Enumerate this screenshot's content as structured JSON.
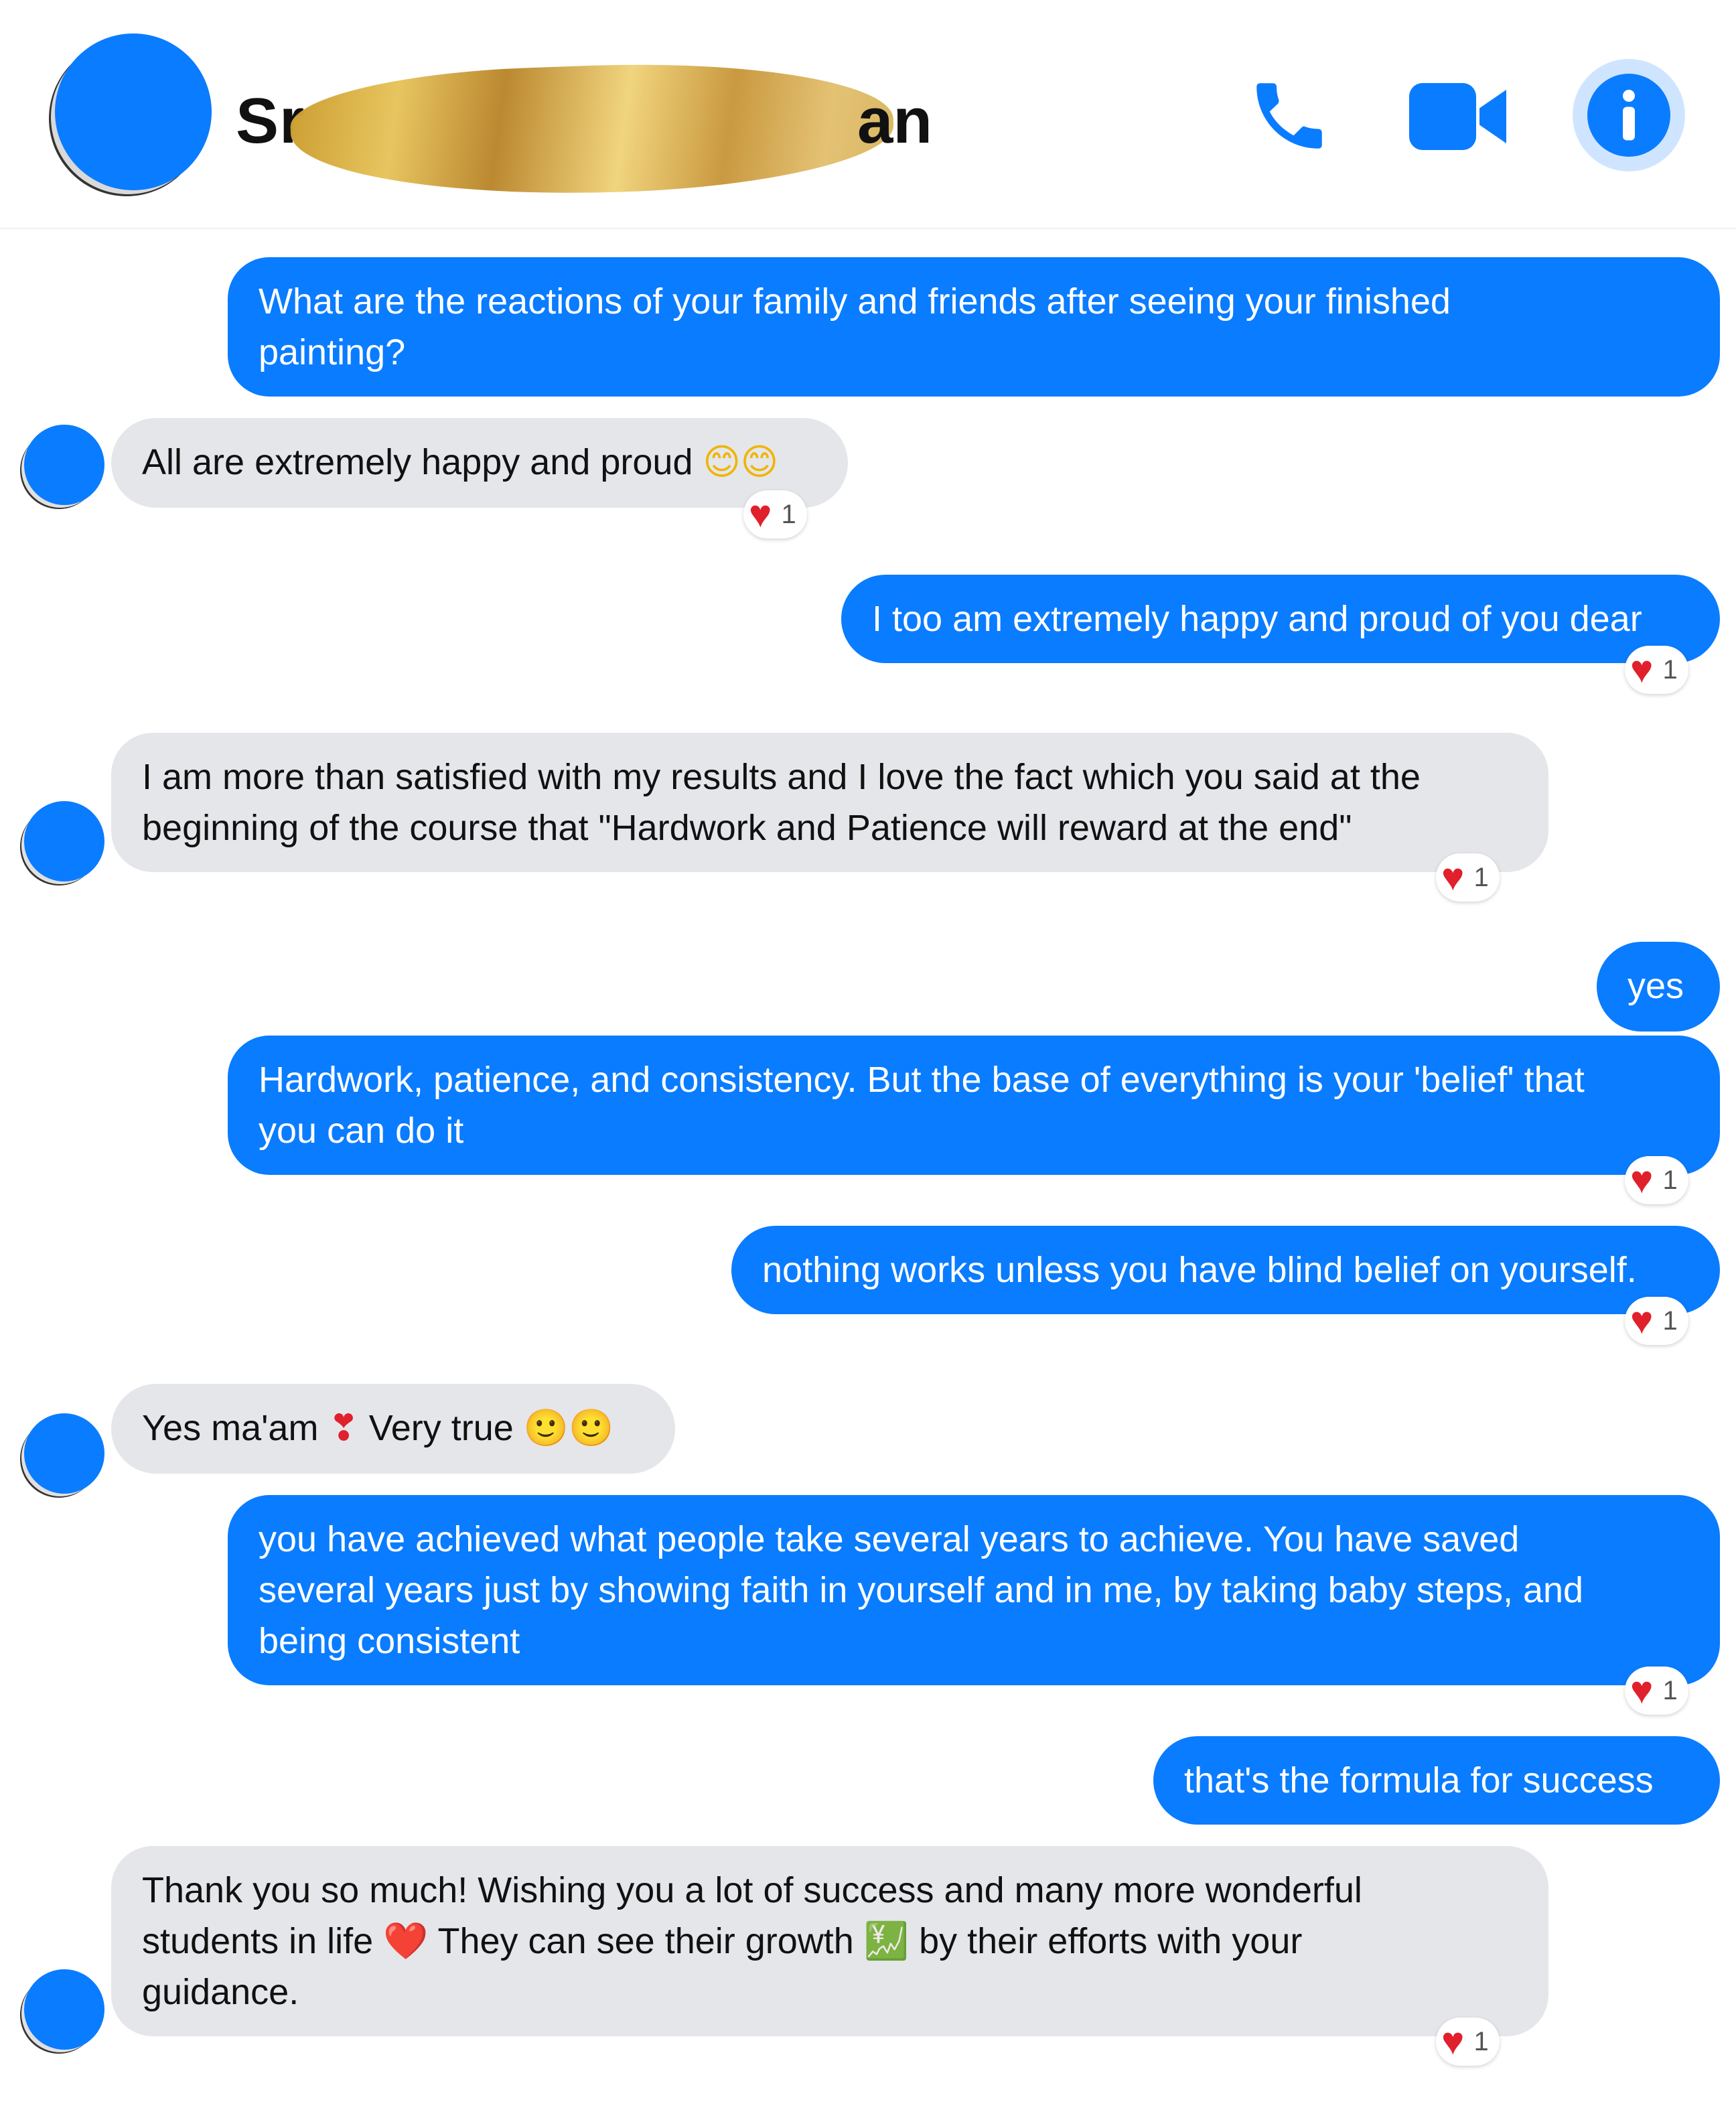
{
  "header": {
    "contact_name_start": "Sr",
    "contact_name_end": "an",
    "icons": [
      "phone-icon",
      "video-camera-icon",
      "info-icon"
    ]
  },
  "colors": {
    "outgoing_bubble": "#0a7cff",
    "incoming_bubble": "#e5e6ea",
    "heart": "#e0202b"
  },
  "messages": [
    {
      "side": "out",
      "lines": [
        "What are the reactions of your family and friends after seeing your finished",
        "painting?"
      ]
    },
    {
      "side": "in",
      "lines": [
        "All are extremely happy and proud"
      ],
      "emoji": "😊😊",
      "reaction": {
        "icon": "heart-icon",
        "count": "1"
      }
    },
    {
      "side": "out",
      "lines": [
        "I too am extremely happy and proud of you dear"
      ],
      "reaction": {
        "icon": "heart-icon",
        "count": "1"
      }
    },
    {
      "side": "in",
      "lines": [
        "I am more than satisfied with my results and I love the fact which you said at the",
        "beginning of the course that \"Hardwork and Patience will reward at the end\""
      ],
      "reaction": {
        "icon": "heart-icon",
        "count": "1"
      }
    },
    {
      "side": "out",
      "lines": [
        "yes"
      ]
    },
    {
      "side": "out",
      "lines": [
        "Hardwork, patience, and consistency. But the base of everything is your 'belief' that",
        "you can do it"
      ],
      "reaction": {
        "icon": "heart-icon",
        "count": "1"
      }
    },
    {
      "side": "out",
      "lines": [
        "nothing works unless you have blind belief on yourself."
      ],
      "reaction": {
        "icon": "heart-icon",
        "count": "1"
      }
    },
    {
      "side": "in",
      "parts": [
        "Yes ma'am",
        "❣",
        "Very true",
        "🙂🙂"
      ]
    },
    {
      "side": "out",
      "lines": [
        "you have achieved what people take several years to achieve. You have saved",
        "several years just by showing faith in yourself and in me, by taking baby steps, and",
        "being consistent"
      ],
      "reaction": {
        "icon": "heart-icon",
        "count": "1"
      }
    },
    {
      "side": "out",
      "lines": [
        "that's the formula for success"
      ]
    },
    {
      "side": "in",
      "parts": [
        "Thank you so much! Wishing you a lot of success and many more wonderful",
        "students in life",
        "❤️",
        "They can see their growth",
        "💹",
        "by their efforts with your",
        "guidance."
      ],
      "reaction": {
        "icon": "heart-icon",
        "count": "1"
      }
    }
  ]
}
